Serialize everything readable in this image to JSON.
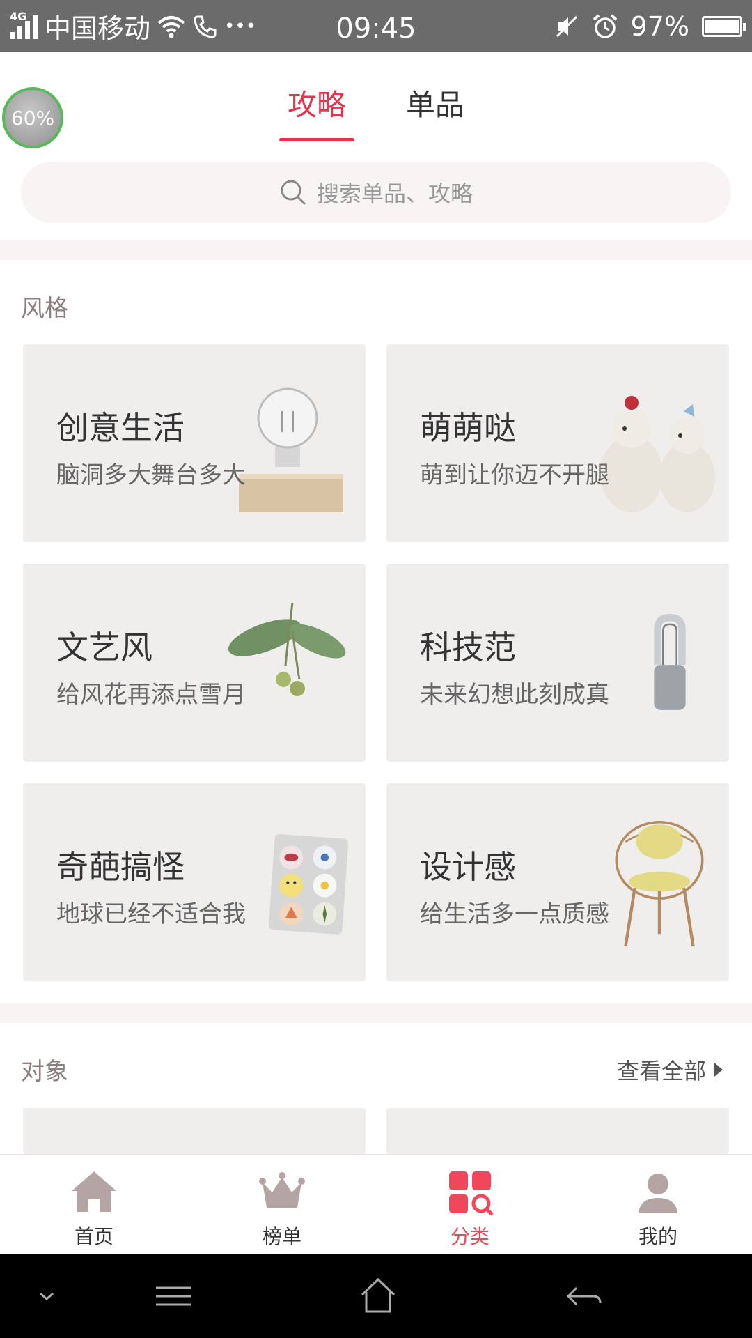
{
  "status_bar": {
    "network_type": "4G",
    "carrier": "中国移动",
    "more": "•••",
    "time": "09:45",
    "battery": "97%"
  },
  "header": {
    "tabs": [
      {
        "label": "攻略",
        "active": true
      },
      {
        "label": "单品",
        "active": false
      }
    ],
    "floating_badge": "60%"
  },
  "search": {
    "placeholder": "搜索单品、攻略"
  },
  "sections": {
    "style": {
      "title": "风格",
      "cards": [
        {
          "title": "创意生活",
          "subtitle": "脑洞多大舞台多大"
        },
        {
          "title": "萌萌哒",
          "subtitle": "萌到让你迈不开腿"
        },
        {
          "title": "文艺风",
          "subtitle": "给风花再添点雪月"
        },
        {
          "title": "科技范",
          "subtitle": "未来幻想此刻成真"
        },
        {
          "title": "奇葩搞怪",
          "subtitle": "地球已经不适合我"
        },
        {
          "title": "设计感",
          "subtitle": "给生活多一点质感"
        }
      ]
    },
    "object": {
      "title": "对象",
      "view_all": "查看全部"
    }
  },
  "tabbar": {
    "items": [
      {
        "label": "首页",
        "icon": "home-icon",
        "active": false
      },
      {
        "label": "榜单",
        "icon": "crown-icon",
        "active": false
      },
      {
        "label": "分类",
        "icon": "category-icon",
        "active": true
      },
      {
        "label": "我的",
        "icon": "user-icon",
        "active": false
      }
    ]
  },
  "colors": {
    "accent": "#e8334a",
    "card_bg": "#f0eeed",
    "section_bg": "#f8f4f3"
  }
}
